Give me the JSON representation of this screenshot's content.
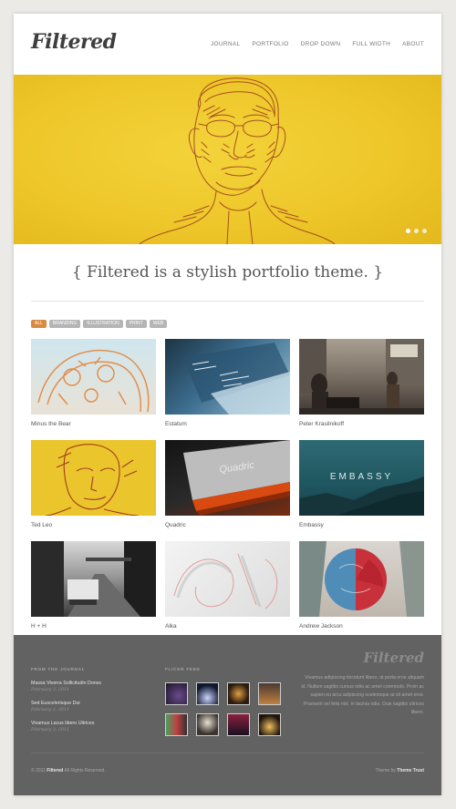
{
  "header": {
    "logo": "Filtered",
    "nav": [
      "JOURNAL",
      "PORTFOLIO",
      "DROP DOWN",
      "FULL WIDTH",
      "ABOUT"
    ]
  },
  "hero": {
    "slides": 3,
    "active_slide": 1,
    "colors": {
      "background": "#eec72a",
      "sketch": "#9b3a1c"
    }
  },
  "tagline": "{ Filtered is a stylish portfolio theme. }",
  "filters": [
    {
      "label": "ALL",
      "active": true
    },
    {
      "label": "BRANDING",
      "active": false
    },
    {
      "label": "ILLUSTRATION",
      "active": false
    },
    {
      "label": "PRINT",
      "active": false
    },
    {
      "label": "WEB",
      "active": false
    }
  ],
  "portfolio": [
    {
      "title": "Minus the Bear",
      "thumb": "orange-sketch-on-blue"
    },
    {
      "title": "Estatum",
      "thumb": "blue-book-pages"
    },
    {
      "title": "Peter Krasilnikoff",
      "thumb": "city-street-photo"
    },
    {
      "title": "Ted Leo",
      "thumb": "yellow-sketch-portrait"
    },
    {
      "title": "Quadric",
      "thumb": "dark-book-cover"
    },
    {
      "title": "Embassy",
      "thumb": "teal-mountain-poster",
      "thumb_text": "EMBASSY"
    },
    {
      "title": "H + H",
      "thumb": "bw-truck-photo"
    },
    {
      "title": "Alka",
      "thumb": "white-embossed-letters"
    },
    {
      "title": "Andrew Jackson",
      "thumb": "red-blue-illustration"
    }
  ],
  "footer": {
    "journal_heading": "FROM THE JOURNAL",
    "journal": [
      {
        "title": "Massa Viverra Sollicitudin Donec",
        "date": "February 3, 2011"
      },
      {
        "title": "Sed Euscelerisque Dui",
        "date": "February 3, 2011"
      },
      {
        "title": "Vivamus Lacus libero Ultrices",
        "date": "February 3, 2011"
      }
    ],
    "flickr_heading": "FLICKR FEED",
    "logo": "Filtered",
    "about": "Vivamus adipiscing tincidunt libero, at porta eros aliquam id. Nullam sagittis cursus odio ac amet commodo. Proin ac sapien eu arcu adipiscing scelerisque at sit amet eros. Praesent vel felis nisl. In lacinia odio. Duis sagittis ultrices libero.",
    "copyright_prefix": "© 2011",
    "copyright_name": "Filtered",
    "copyright_suffix": "All Rights Reserved.",
    "credit_prefix": "Theme by",
    "credit_name": "Theme Trust"
  }
}
